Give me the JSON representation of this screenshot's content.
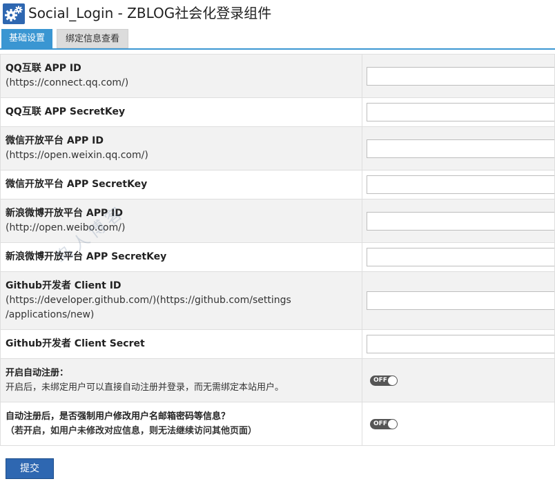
{
  "header": {
    "icon": "gear-icon",
    "title": "Social_Login - ZBLOG社会化登录组件"
  },
  "tabs": [
    {
      "label": "基础设置",
      "active": true
    },
    {
      "label": "绑定信息查看",
      "active": false
    }
  ],
  "colors": {
    "accent": "#3a96d2",
    "brand": "#2e67b1",
    "row_alt": "#f2f2f2",
    "toggle_off": "#555555"
  },
  "rows": [
    {
      "label": "QQ互联 APP ID",
      "sub": "(https://connect.qq.com/)",
      "control": "input",
      "value": ""
    },
    {
      "label": "QQ互联 APP SecretKey",
      "control": "input",
      "value": ""
    },
    {
      "label": "微信开放平台 APP ID",
      "sub": "(https://open.weixin.qq.com/)",
      "control": "input",
      "value": ""
    },
    {
      "label": "微信开放平台 APP SecretKey",
      "control": "input",
      "value": ""
    },
    {
      "label": "新浪微博开放平台 APP ID",
      "sub": "(http://open.weibo.com/)",
      "control": "input",
      "value": ""
    },
    {
      "label": "新浪微博开放平台 APP SecretKey",
      "control": "input",
      "value": ""
    },
    {
      "label": "Github开发者 Client ID",
      "sub": "(https://developer.github.com/)(https://github.com/settings",
      "sub2": "/applications/new)",
      "control": "input",
      "value": ""
    },
    {
      "label": "Github开发者 Client Secret",
      "control": "input",
      "value": ""
    },
    {
      "label": "开启自动注册：",
      "sub": "开启后，未绑定用户可以直接自动注册并登录，而无需绑定本站用户。",
      "control": "toggle",
      "toggle_label": "OFF",
      "toggle_on": false
    },
    {
      "label": "自动注册后，是否强制用户修改用户名邮箱密码等信息？",
      "sub": "（若开启，如用户未修改对应信息，则无法继续访问其他页面）",
      "control": "toggle",
      "toggle_label": "OFF",
      "toggle_on": false
    }
  ],
  "submit": {
    "label": "提交"
  },
  "watermark": {
    "text": "鸟人博客"
  }
}
